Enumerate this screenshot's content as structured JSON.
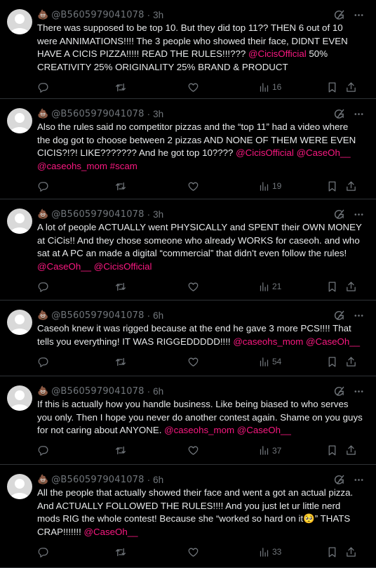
{
  "tweets": [
    {
      "handle": "@B5605979041078",
      "time": "3h",
      "body": [
        {
          "t": "text",
          "v": "There was supposed to be top 10. But they did top 11?? THEN 6 out of 10 were ANNIMATIONS!!!! The 3 people who showed their face, DIDNT EVEN HAVE A CICIS PIZZA!!!!! READ THE RULES!!!??? "
        },
        {
          "t": "mention",
          "v": "@CicisOfficial"
        },
        {
          "t": "text",
          "v": "  50% CREATIVITY 25% ORIGINALITY 25% BRAND & PRODUCT"
        }
      ],
      "views": "16",
      "height": 141
    },
    {
      "handle": "@B5605979041078",
      "time": "3h",
      "body": [
        {
          "t": "text",
          "v": "Also the rules said no competitor pizzas and the “top 11” had a video where the dog got to choose between 2 pizzas AND NONE OF THEM WERE EVEN CICIS?!?! LIKE??????? And he got top 10???? "
        },
        {
          "t": "mention",
          "v": "@CicisOfficial"
        },
        {
          "t": "text",
          "v": " "
        },
        {
          "t": "mention",
          "v": "@CaseOh__"
        },
        {
          "t": "text",
          "v": " "
        },
        {
          "t": "mention",
          "v": "@caseohs_mom"
        },
        {
          "t": "text",
          "v": " "
        },
        {
          "t": "mention",
          "v": "#scam"
        }
      ],
      "views": "19",
      "height": 143
    },
    {
      "handle": "@B5605979041078",
      "time": "3h",
      "body": [
        {
          "t": "text",
          "v": "A lot of people ACTUALLY went PHYSICALLY and SPENT their OWN MONEY at CiCis!! And they chose someone who already WORKS for caseoh. and who sat at A PC an made a digital “commercial” that didn’t even follow the rules! "
        },
        {
          "t": "mention",
          "v": "@CaseOh__"
        },
        {
          "t": "text",
          "v": " "
        },
        {
          "t": "mention",
          "v": "@CicisOfficial"
        }
      ],
      "views": "21",
      "height": 144
    },
    {
      "handle": "@B5605979041078",
      "time": "6h",
      "body": [
        {
          "t": "text",
          "v": "Caseoh knew it was rigged because at the end he gave 3 more PCS!!!! That tells you everything! IT WAS RIGGEDDDDD!!!! "
        },
        {
          "t": "mention",
          "v": "@caseohs_mom"
        },
        {
          "t": "text",
          "v": " "
        },
        {
          "t": "mention",
          "v": "@CaseOh__"
        }
      ],
      "views": "54",
      "height": 108
    },
    {
      "handle": "@B5605979041078",
      "time": "6h",
      "body": [
        {
          "t": "text",
          "v": "If this is actually how you handle business. Like being biased to who serves you only. Then I hope you never do another contest again. Shame on you guys for not caring about ANYONE. "
        },
        {
          "t": "mention",
          "v": "@caseohs_mom"
        },
        {
          "t": "text",
          "v": " "
        },
        {
          "t": "mention",
          "v": "@CaseOh__"
        }
      ],
      "views": "37",
      "height": 126
    },
    {
      "handle": "@B5605979041078",
      "time": "6h",
      "body": [
        {
          "t": "text",
          "v": "All the people that actually showed their face and went a got an actual pizza. And ACTUALLY FOLLOWED THE RULES!!!! And you just let ur little nerd mods RIG the whole contest! Because she “worked so hard on it🥺” THATS CRAP!!!!!!! "
        },
        {
          "t": "mention",
          "v": "@CaseOh__"
        }
      ],
      "views": "33",
      "height": 147
    }
  ],
  "emoji": "💩",
  "separator": "·",
  "colors": {
    "background": "#000000",
    "text": "#e7e9ea",
    "muted": "#71767b",
    "mention": "#f91880",
    "divider": "#2f3336"
  },
  "icons": [
    "reply-icon",
    "retweet-icon",
    "like-icon",
    "views-icon",
    "bookmark-icon",
    "share-icon",
    "grok-icon",
    "more-icon"
  ]
}
